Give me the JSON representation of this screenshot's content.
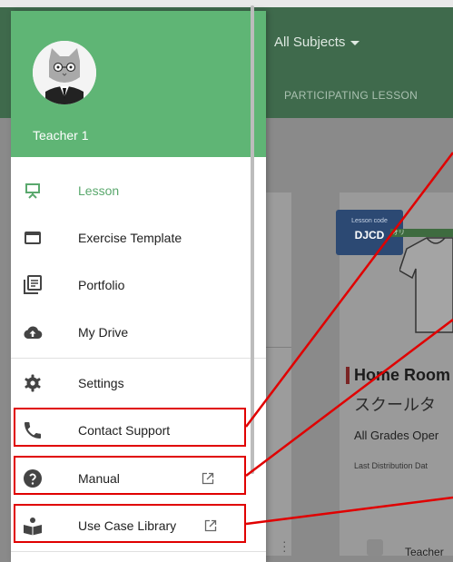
{
  "background": {
    "subject_filter": "All Subjects",
    "tab_label": "PARTICIPATING LESSON",
    "lesson_code_label": "Lesson code",
    "lesson_code": "DJCD",
    "tag_text": "オリ",
    "card_title": "Home Room",
    "card_subtitle": "スクールタ",
    "card_grades": "All Grades Oper",
    "card_date_label": "Last Distribution Dat",
    "card_teacher": "Teacher"
  },
  "drawer": {
    "user_name": "Teacher 1",
    "items": [
      {
        "label": "Lesson",
        "icon": "presentation-icon",
        "active": true
      },
      {
        "label": "Exercise Template",
        "icon": "window-icon",
        "active": false
      },
      {
        "label": "Portfolio",
        "icon": "library-books-icon",
        "active": false
      },
      {
        "label": "My Drive",
        "icon": "cloud-upload-icon",
        "active": false
      },
      {
        "label": "Settings",
        "icon": "gear-icon",
        "active": false
      },
      {
        "label": "Contact Support",
        "icon": "phone-icon",
        "active": false
      },
      {
        "label": "Manual",
        "icon": "help-circle-icon",
        "active": false,
        "external": true
      },
      {
        "label": "Use Case Library",
        "icon": "book-reader-icon",
        "active": false,
        "external": true
      }
    ]
  },
  "colors": {
    "drawer_header": "#5fb575",
    "accent": "#5aa86d",
    "annotation": "#e00000"
  }
}
